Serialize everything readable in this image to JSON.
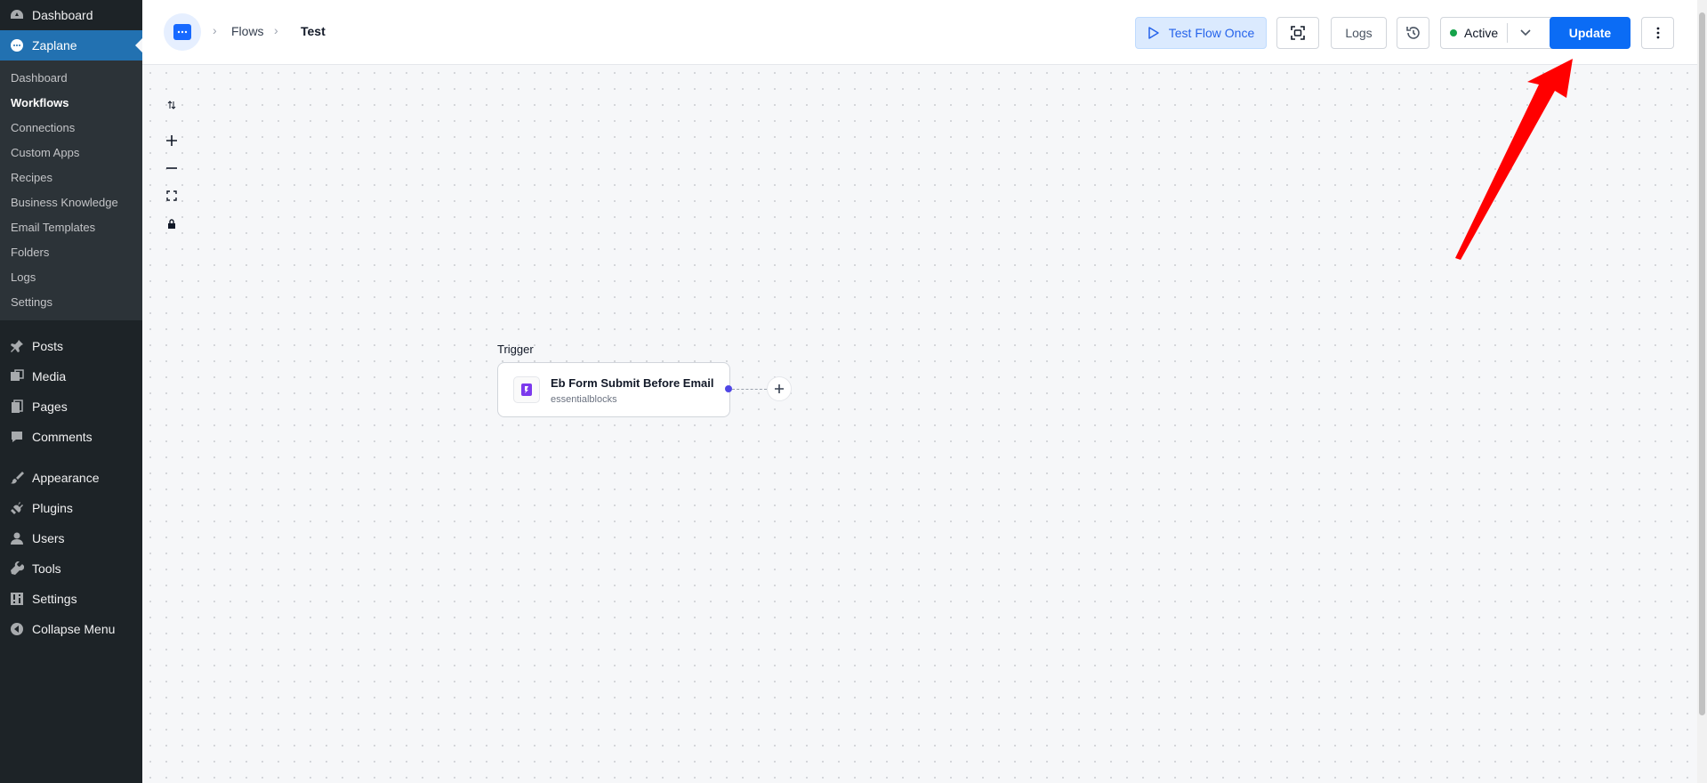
{
  "sidebar": {
    "dashboard": "Dashboard",
    "zaplane": "Zaplane",
    "submenu": [
      "Dashboard",
      "Workflows",
      "Connections",
      "Custom Apps",
      "Recipes",
      "Business Knowledge",
      "Email Templates",
      "Folders",
      "Logs",
      "Settings"
    ],
    "posts": "Posts",
    "media": "Media",
    "pages": "Pages",
    "comments": "Comments",
    "appearance": "Appearance",
    "plugins": "Plugins",
    "users": "Users",
    "tools": "Tools",
    "settings": "Settings",
    "collapse": "Collapse Menu"
  },
  "breadcrumb": {
    "flows": "Flows",
    "current": "Test"
  },
  "toolbar": {
    "test_flow": "Test Flow Once",
    "logs": "Logs",
    "status": "Active",
    "update": "Update"
  },
  "canvas": {
    "trigger_label": "Trigger",
    "node_title": "Eb Form Submit Before Email",
    "node_subtitle": "essentialblocks"
  },
  "colors": {
    "accent": "#0b6cf5",
    "status_active": "#16a34a",
    "annotation_arrow": "#ff0000"
  }
}
